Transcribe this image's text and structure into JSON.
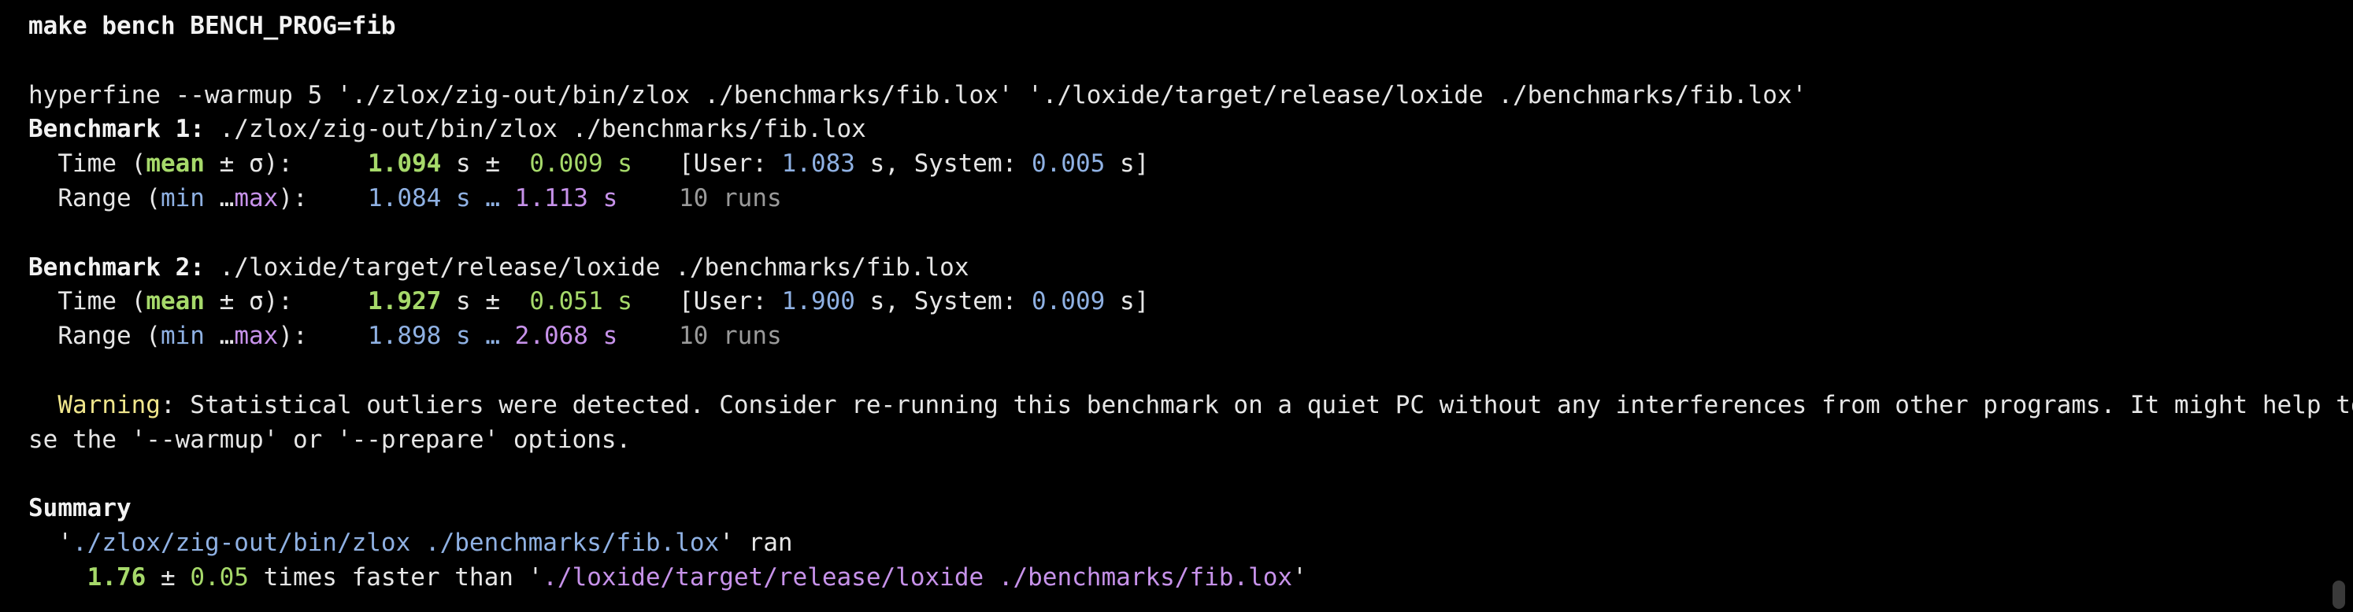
{
  "terminal": {
    "command": "make bench BENCH_PROG=fib",
    "hyperfine_cmd": "hyperfine --warmup 5 './zlox/zig-out/bin/zlox ./benchmarks/fib.lox' './loxide/target/release/loxide ./benchmarks/fib.lox'",
    "benchmarks": [
      {
        "header_label": "Benchmark 1:",
        "header_cmd": "./zlox/zig-out/bin/zlox ./benchmarks/fib.lox",
        "time_label_a": "Time (",
        "time_mean": "mean",
        "time_label_b": " ± σ):",
        "mean_value": "1.094",
        "mean_unit": " s ±  ",
        "stddev_value": "0.009",
        "stddev_unit": " s",
        "user_prefix": "[User: ",
        "user_value": "1.083",
        "user_mid": " s, System: ",
        "system_value": "0.005",
        "system_suffix": " s]",
        "range_label_a": "Range (",
        "range_min": "min",
        "range_mid": " …",
        "range_max": "max",
        "range_label_b": "):",
        "min_value": "1.084",
        "min_unit": " s … ",
        "max_value": "1.113",
        "max_unit": " s",
        "runs": "10 runs"
      },
      {
        "header_label": "Benchmark 2:",
        "header_cmd": "./loxide/target/release/loxide ./benchmarks/fib.lox",
        "time_label_a": "Time (",
        "time_mean": "mean",
        "time_label_b": " ± σ):",
        "mean_value": "1.927",
        "mean_unit": " s ±  ",
        "stddev_value": "0.051",
        "stddev_unit": " s",
        "user_prefix": "[User: ",
        "user_value": "1.900",
        "user_mid": " s, System: ",
        "system_value": "0.009",
        "system_suffix": " s]",
        "range_label_a": "Range (",
        "range_min": "min",
        "range_mid": " …",
        "range_max": "max",
        "range_label_b": "):",
        "min_value": "1.898",
        "min_unit": " s … ",
        "max_value": "2.068",
        "max_unit": " s",
        "runs": "10 runs"
      }
    ],
    "warning": {
      "label": "Warning",
      "text_line1": ": Statistical outliers were detected. Consider re-running this benchmark on a quiet PC without any interferences from other programs. It might help to u",
      "text_line2": "se the '--warmup' or '--prepare' options."
    },
    "summary": {
      "title": "Summary",
      "quote_open": "'",
      "fastest_cmd": "./zlox/zig-out/bin/zlox ./benchmarks/fib.lox",
      "quote_close_ran": "' ran",
      "ratio": "1.76",
      "plusminus": " ± ",
      "ratio_err": "0.05",
      "times_faster": " times faster than '",
      "slower_cmd": "./loxide/target/release/loxide ./benchmarks/fib.lox",
      "quote_end": "'"
    },
    "colors": {
      "background": "#000000",
      "foreground": "#e6e6e6",
      "green": "#a6d96a",
      "blue": "#8fb1e3",
      "magenta": "#c792ea",
      "dim": "#9a9a9a"
    }
  }
}
